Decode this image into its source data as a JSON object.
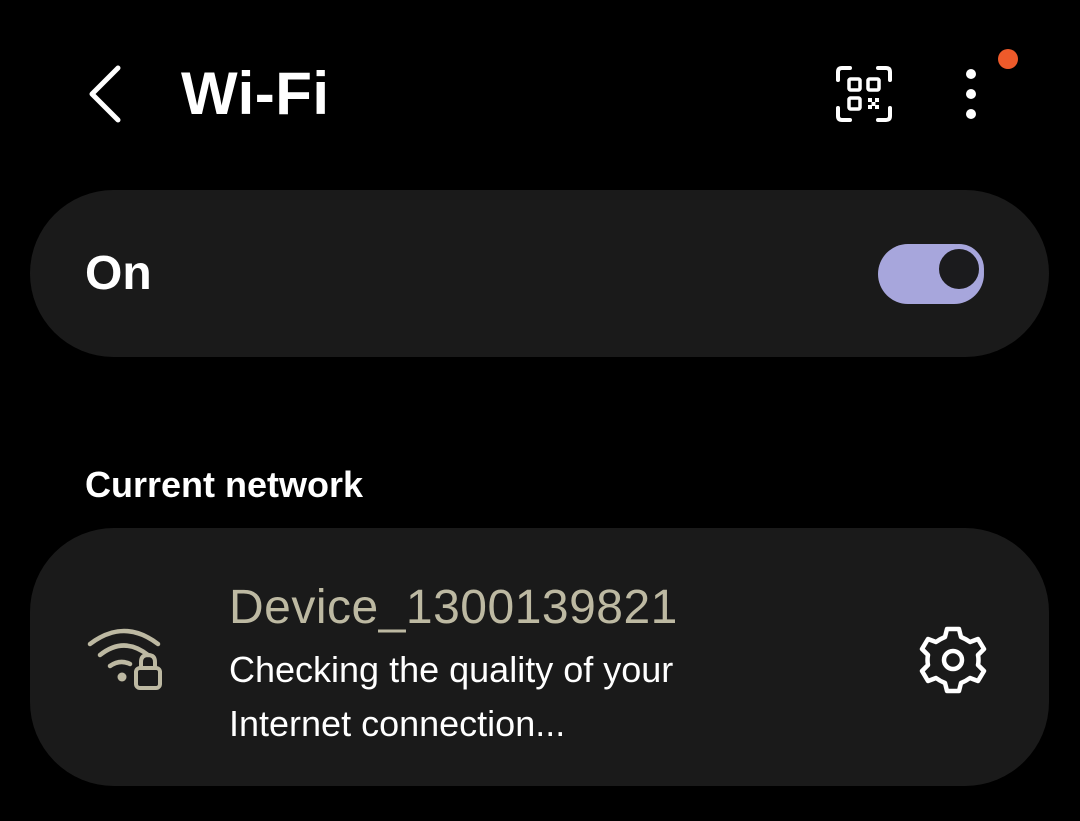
{
  "header": {
    "title": "Wi-Fi",
    "icons": {
      "back": "chevron-left-icon",
      "qr": "qr-code-scan-icon",
      "more": "more-vertical-icon"
    },
    "notification_dot_color": "#ee5a2a"
  },
  "master_switch": {
    "label": "On",
    "checked": true,
    "track_color": "#a7a6dc"
  },
  "current_network": {
    "section_title": "Current network",
    "name": "Device_1300139821",
    "status": "Checking the quality of your Internet connection...",
    "secured": true,
    "icons": {
      "signal": "wifi-lock-icon",
      "settings": "gear-icon"
    },
    "name_color": "#bdb9a2"
  },
  "colors": {
    "background": "#000000",
    "card": "#1a1a1a",
    "text": "#ffffff"
  }
}
